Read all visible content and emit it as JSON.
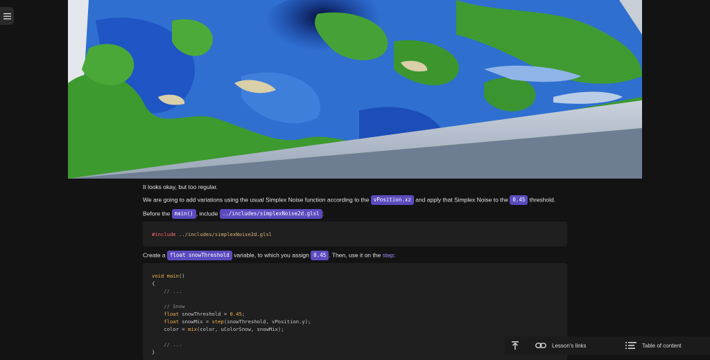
{
  "icons": {
    "menu": "hamburger-menu-icon",
    "scroll_top": "arrow-to-top-icon",
    "links": "link-icon",
    "toc": "list-icon"
  },
  "colors": {
    "accent": "#5b4bbf",
    "link": "#9d8cff",
    "code_bg": "#1f1f1f",
    "page_bg": "#131313"
  },
  "content": {
    "p1": "It looks okay, but too regular.",
    "p2": {
      "before": "We are going to add variations using the usual Simplex Noise function according to the ",
      "chip1": "vPosition.xz",
      "middle": " and apply that Simplex Noise to the ",
      "chip2": "0.45",
      "after": " threshold."
    },
    "p3": {
      "before": "Before the ",
      "chip1": "main()",
      "middle": ", include ",
      "chip2": "../includes/simplexNoise2d.glsl",
      "after": ":"
    },
    "code1": {
      "directive": "#include",
      "path": " ../includes/simplexNoise2d.glsl"
    },
    "p4": {
      "before": "Create a ",
      "chip1": "float snowThreshold",
      "middle": " variable, to which you assign ",
      "chip2": "0.45",
      "after": ". Then, use it on the ",
      "link": "step",
      "end": ":"
    },
    "code2": {
      "l1_kw": "void",
      "l1_fn": " main",
      "l1_rest": "()",
      "l2": "{",
      "l3": "    // ...",
      "l5": "    // Snow",
      "l6_kw": "    float",
      "l6_rest": " snowThreshold = ",
      "l6_num": "0.45",
      "l6_end": ";",
      "l7_kw": "    float",
      "l7_rest": " snowMix = ",
      "l7_fn": "step",
      "l7_end": "(snowThreshold, vPosition.y);",
      "l8_rest": "    color = ",
      "l8_fn": "mix",
      "l8_end": "(color, uColorSnow, snowMix);",
      "l10": "    // ...",
      "l11": "}"
    }
  },
  "bottom_bar": {
    "links_label": "Lesson's links",
    "toc_label": "Table of content"
  }
}
